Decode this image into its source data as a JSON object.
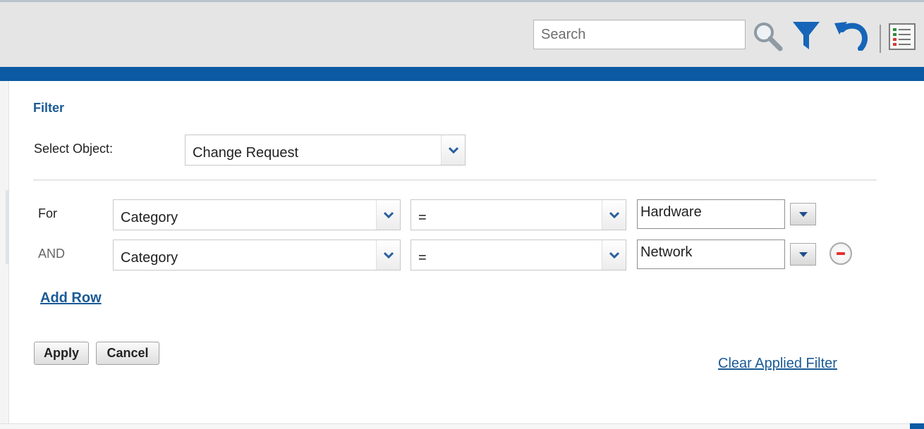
{
  "toolbar": {
    "search_placeholder": "Search",
    "icons": [
      "search-icon",
      "filter-icon",
      "undo-icon",
      "column-list-icon"
    ]
  },
  "filter": {
    "title": "Filter",
    "select_object_label": "Select Object:",
    "selected_object": "Change Request",
    "rows": [
      {
        "conjunction": "For",
        "field": "Category",
        "operator": "=",
        "value": "Hardware"
      },
      {
        "conjunction": "AND",
        "field": "Category",
        "operator": "=",
        "value": "Network"
      }
    ],
    "add_row_label": "Add Row",
    "apply_label": "Apply",
    "cancel_label": "Cancel",
    "clear_label": "Clear Applied Filter"
  },
  "colors": {
    "accent_blue": "#0b5aa3",
    "title_blue": "#1a5a96",
    "toolbar_bg": "#e5e5e5",
    "remove_red": "#e53030"
  }
}
